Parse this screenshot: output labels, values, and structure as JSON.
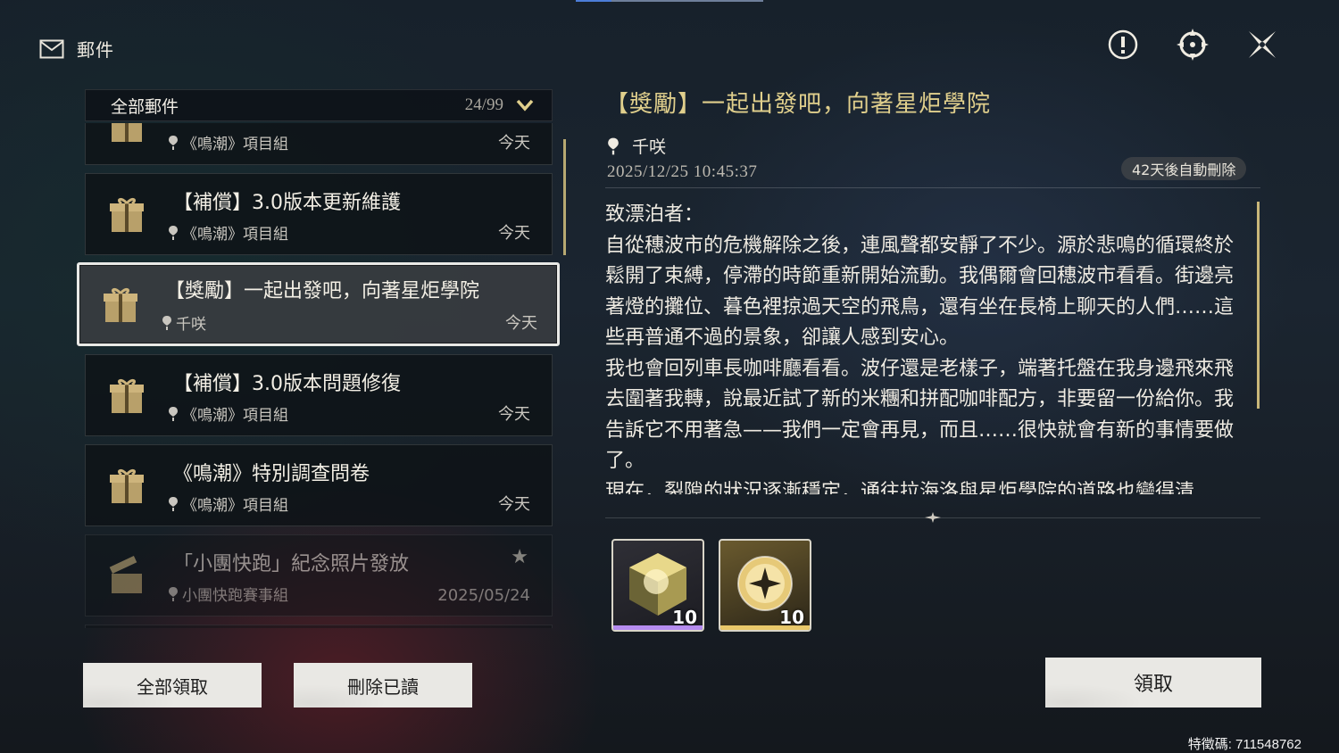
{
  "header": {
    "title": "郵件"
  },
  "list": {
    "filter_label": "全部郵件",
    "count": "24/99",
    "items": [
      {
        "title": "",
        "sender": "《鳴潮》項目組",
        "date": "今天"
      },
      {
        "title": "【補償】3.0版本更新維護",
        "sender": "《鳴潮》項目組",
        "date": "今天"
      },
      {
        "title": "【獎勵】一起出發吧，向著星炬學院",
        "sender": "千咲",
        "date": "今天"
      },
      {
        "title": "【補償】3.0版本問題修復",
        "sender": "《鳴潮》項目組",
        "date": "今天"
      },
      {
        "title": "《鳴潮》特別調查問卷",
        "sender": "《鳴潮》項目組",
        "date": "今天"
      },
      {
        "title": "「小團快跑」紀念照片發放",
        "sender": "小團快跑賽事組",
        "date": "2025/05/24"
      }
    ]
  },
  "buttons": {
    "claim_all": "全部領取",
    "delete_read": "刪除已讀",
    "claim": "領取"
  },
  "detail": {
    "title": "【獎勵】一起出發吧，向著星炬學院",
    "sender": "千咲",
    "time": "2025/12/25 10:45:37",
    "auto_delete": "42天後自動刪除",
    "body": [
      "致漂泊者：",
      "自從穗波市的危機解除之後，連風聲都安靜了不少。源於悲鳴的循環終於鬆開了束縛，停滯的時節重新開始流動。我偶爾會回穗波市看看。街邊亮著燈的攤位、暮色裡掠過天空的飛鳥，還有坐在長椅上聊天的人們……這些再普通不過的景象，卻讓人感到安心。",
      "我也會回列車長咖啡廳看看。波仔還是老樣子，端著托盤在我身邊飛來飛去圍著我轉，說最近試了新的米糰和拼配咖啡配方，非要留一份給你。我告訴它不用著急——我們一定會再見，而且……很快就會有新的事情要做了。",
      "現在，裂隙的狀況逐漸穩定，通往拉海洛與星炬學院的道路也變得清"
    ],
    "rewards": [
      {
        "qty": "10",
        "icon": "crystal-cube-icon",
        "rarity_color": "#b68cf0"
      },
      {
        "qty": "10",
        "icon": "star-orb-icon",
        "rarity_color": "#e9c86a"
      }
    ]
  },
  "uid": "特徵碼: 711548762",
  "colors": {
    "accent_gold": "#e0cf8c",
    "scroll_gold": "#c9b779"
  }
}
